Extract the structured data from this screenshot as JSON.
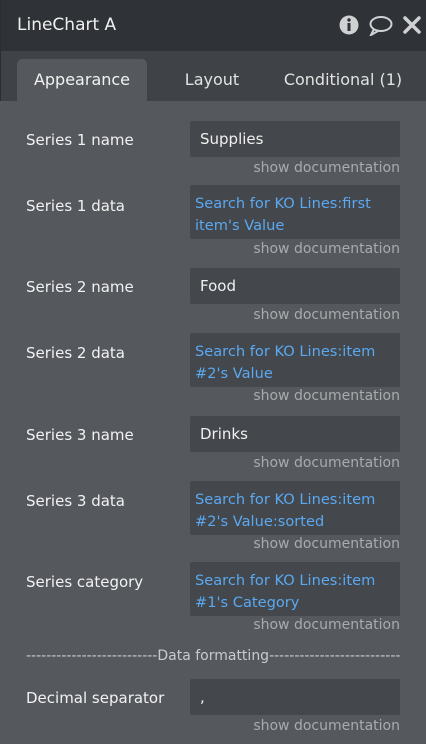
{
  "window": {
    "title": "LineChart A"
  },
  "icons": {
    "info": "info-icon",
    "comment": "comment-icon",
    "close": "close-icon"
  },
  "tabs": [
    {
      "label": "Appearance",
      "active": true
    },
    {
      "label": "Layout",
      "active": false
    },
    {
      "label": "Conditional (1)",
      "active": false
    }
  ],
  "doc_link": "show documentation",
  "fields": {
    "series1_name": {
      "label": "Series 1 name",
      "value": "Supplies"
    },
    "series1_data": {
      "label": "Series 1 data",
      "line1": "Search for KO Lines:first",
      "line2": "item's Value"
    },
    "series2_name": {
      "label": "Series 2 name",
      "value": "Food"
    },
    "series2_data": {
      "label": "Series 2 data",
      "line1": "Search for KO Lines:item",
      "line2": "#2's Value"
    },
    "series3_name": {
      "label": "Series 3 name",
      "value": "Drinks"
    },
    "series3_data": {
      "label": "Series 3 data",
      "line1": "Search for KO Lines:item",
      "line2": "#2's Value:sorted"
    },
    "series_category": {
      "label": "Series category",
      "line1": "Search for KO Lines:item",
      "line2": "#1's Category"
    },
    "decimal_separator": {
      "label": "Decimal separator",
      "value": ","
    }
  },
  "section_divider": "--------------------------Data formatting--------------------------",
  "colors": {
    "dynamic_expression": "#5aa9f2",
    "panel": "#55585d",
    "titlebar": "#2f3236"
  }
}
